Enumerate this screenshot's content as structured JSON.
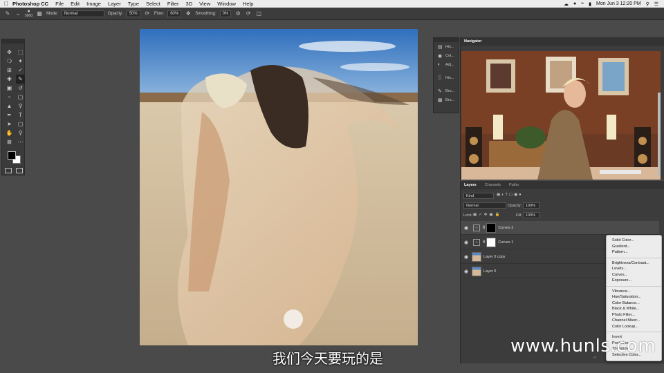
{
  "menubar": {
    "app": "Photoshop CC",
    "items": [
      "File",
      "Edit",
      "Image",
      "Layer",
      "Type",
      "Select",
      "Filter",
      "3D",
      "View",
      "Window",
      "Help"
    ],
    "clock": "Mon Jun 3  12:20 PM"
  },
  "options": {
    "brush_size": "5000",
    "mode_label": "Mode:",
    "mode_value": "Normal",
    "opacity_label": "Opacity:",
    "opacity_value": "50%",
    "flow_label": "Flow:",
    "flow_value": "60%",
    "smoothing_label": "Smoothing:",
    "smoothing_value": "0%"
  },
  "dock": {
    "items": [
      "His...",
      "Col...",
      "Adj...",
      "His...",
      "Bru...",
      "Bru..."
    ]
  },
  "navigator": {
    "tab": "Navigator"
  },
  "layers": {
    "tabs": [
      "Layers",
      "Channels",
      "Paths"
    ],
    "kind_value": "Kind",
    "blend_value": "Normal",
    "opacity_label": "Opacity:",
    "opacity_value": "100%",
    "lock_label": "Lock:",
    "fill_label": "Fill:",
    "fill_value": "100%",
    "rows": [
      {
        "name": "Curves 2"
      },
      {
        "name": "Curves 1"
      },
      {
        "name": "Layer 0 copy"
      },
      {
        "name": "Layer 0"
      }
    ]
  },
  "adjustment_menu": {
    "items": [
      "Solid Color...",
      "Gradient...",
      "Pattern...",
      "---",
      "Brightness/Contrast...",
      "Levels...",
      "Curves...",
      "Exposure...",
      "---",
      "Vibrance...",
      "Hue/Saturation...",
      "Color Balance...",
      "Black & White...",
      "Photo Filter...",
      "Channel Mixer...",
      "Color Lookup...",
      "---",
      "Invert",
      "Posterize...",
      "Threshold...",
      "Selective Color..."
    ]
  },
  "overlay": {
    "watermark": "www.hunls.com",
    "subtitle": "我们今天要玩的是"
  },
  "colors": {
    "ui_dark": "#3c3c3c",
    "menu_bg": "#ececec",
    "sky": "#3f7fc4",
    "sand": "#cdb99a"
  }
}
